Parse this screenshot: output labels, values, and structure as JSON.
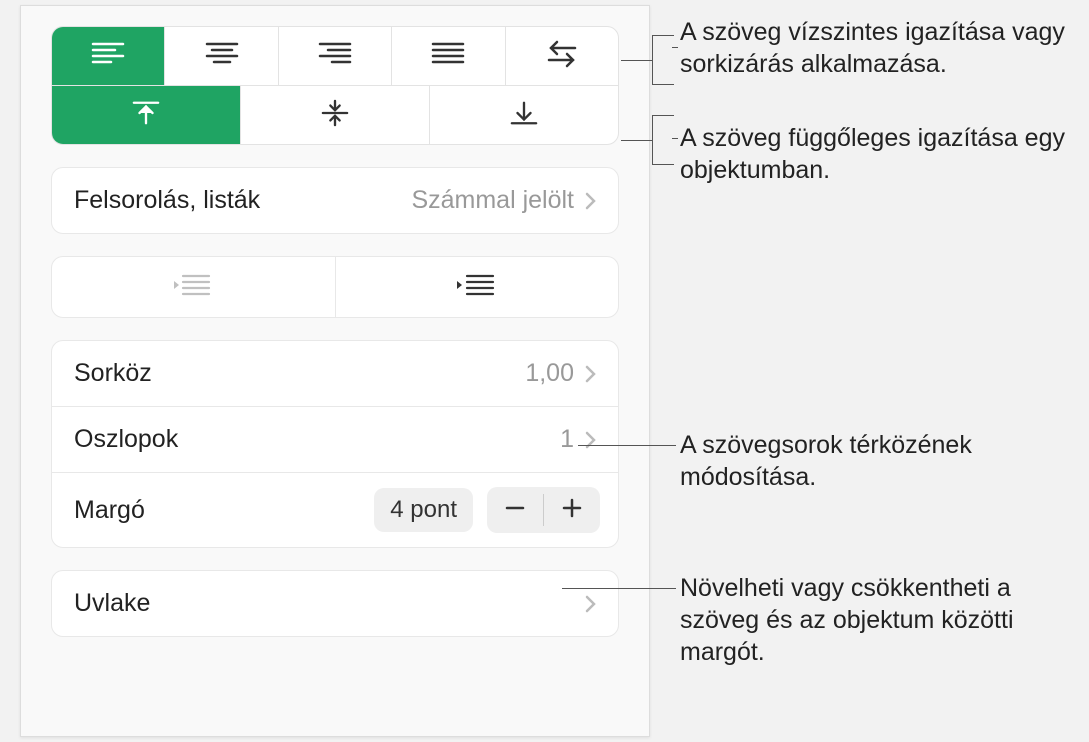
{
  "bulletsLists": {
    "label": "Felsorolás, listák",
    "value": "Számmal jelölt"
  },
  "lineSpacing": {
    "label": "Sorköz",
    "value": "1,00"
  },
  "columns": {
    "label": "Oszlopok",
    "value": "1"
  },
  "margin": {
    "label": "Margó",
    "value": "4 pont"
  },
  "dropCaps": {
    "label": "Uvlake"
  },
  "callouts": {
    "horiz": "A szöveg vízszintes igazítása vagy sorkizárás alkalmazása.",
    "vert": "A szöveg függőleges igazítása egy objektumban.",
    "spacing": "A szövegsorok térközének módosítása.",
    "marginCallout": "Növelheti vagy csökkentheti a szöveg és az objektum közötti margót."
  }
}
